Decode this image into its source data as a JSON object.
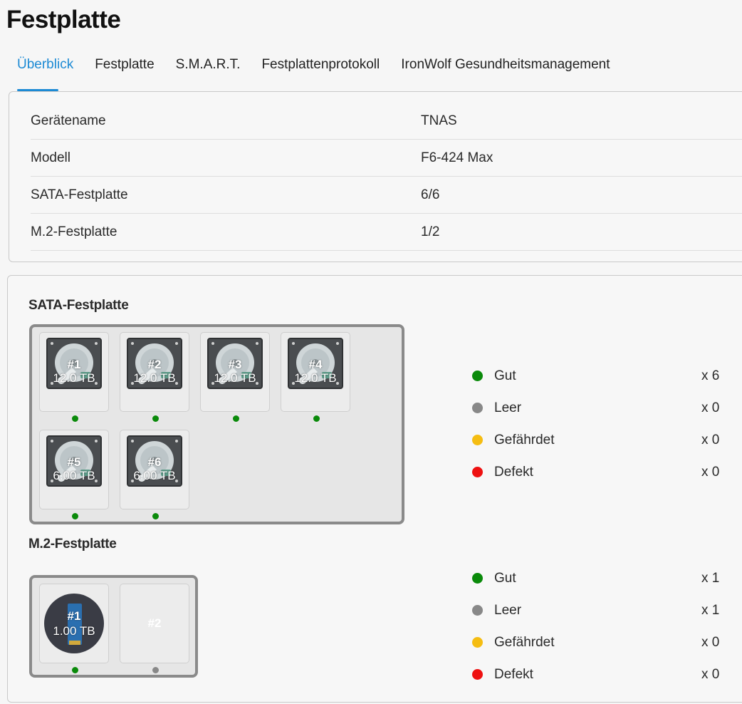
{
  "page": {
    "title": "Festplatte"
  },
  "tabs": [
    {
      "label": "Überblick",
      "active": true
    },
    {
      "label": "Festplatte"
    },
    {
      "label": "S.M.A.R.T."
    },
    {
      "label": "Festplattenprotokoll"
    },
    {
      "label": "IronWolf Gesundheitsmanagement"
    }
  ],
  "info": [
    {
      "label": "Gerätename",
      "value": "TNAS"
    },
    {
      "label": "Modell",
      "value": "F6-424 Max"
    },
    {
      "label": "SATA-Festplatte",
      "value": "6/6"
    },
    {
      "label": "M.2-Festplatte",
      "value": "1/2"
    }
  ],
  "colors": {
    "good": "#0a8a0a",
    "empty": "#888888",
    "warning": "#f5bd12",
    "defect": "#ee1111",
    "accent": "#1c8ad4"
  },
  "sata": {
    "title": "SATA-Festplatte",
    "slots": [
      {
        "num": "#1",
        "capacity": "12.0 TB",
        "status": "good"
      },
      {
        "num": "#2",
        "capacity": "12.0 TB",
        "status": "good"
      },
      {
        "num": "#3",
        "capacity": "12.0 TB",
        "status": "good"
      },
      {
        "num": "#4",
        "capacity": "12.0 TB",
        "status": "good"
      },
      {
        "num": "#5",
        "capacity": "6.00 TB",
        "status": "good"
      },
      {
        "num": "#6",
        "capacity": "6.00 TB",
        "status": "good"
      }
    ],
    "legend": [
      {
        "label": "Gut",
        "count": "x 6",
        "status": "good"
      },
      {
        "label": "Leer",
        "count": "x 0",
        "status": "empty"
      },
      {
        "label": "Gefährdet",
        "count": "x 0",
        "status": "warning"
      },
      {
        "label": "Defekt",
        "count": "x 0",
        "status": "defect"
      }
    ]
  },
  "m2": {
    "title": "M.2-Festplatte",
    "slots": [
      {
        "num": "#1",
        "capacity": "1.00 TB",
        "status": "good"
      },
      {
        "num": "#2",
        "capacity": "",
        "status": "empty"
      }
    ],
    "legend": [
      {
        "label": "Gut",
        "count": "x 1",
        "status": "good"
      },
      {
        "label": "Leer",
        "count": "x 1",
        "status": "empty"
      },
      {
        "label": "Gefährdet",
        "count": "x 0",
        "status": "warning"
      },
      {
        "label": "Defekt",
        "count": "x 0",
        "status": "defect"
      }
    ]
  }
}
